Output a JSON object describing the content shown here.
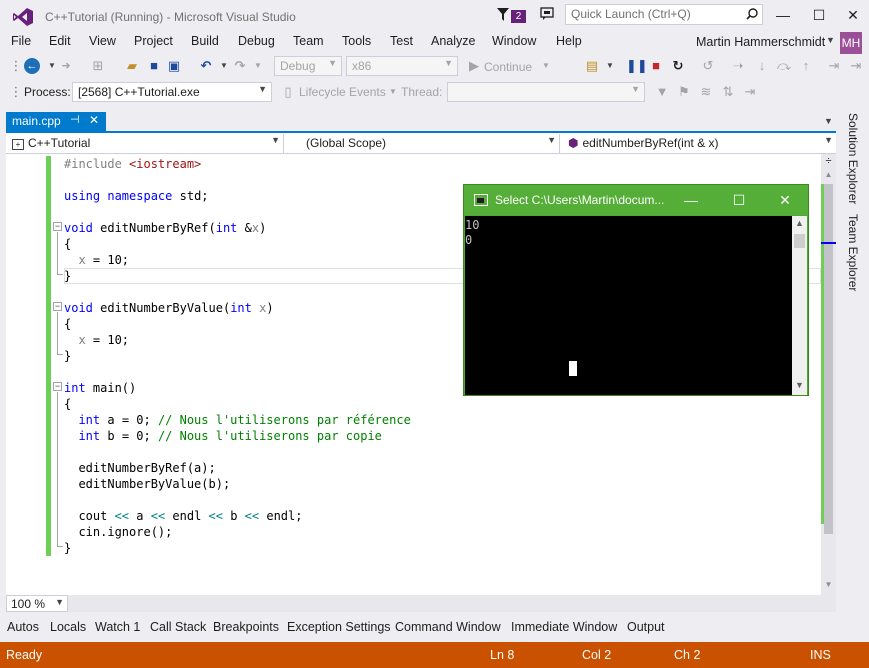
{
  "window": {
    "title": "C++Tutorial (Running) - Microsoft Visual Studio",
    "notifications": "2",
    "quick_launch_placeholder": "Quick Launch (Ctrl+Q)",
    "min": "—",
    "max": "☐",
    "close": "✕"
  },
  "menu": {
    "items": [
      "File",
      "Edit",
      "View",
      "Project",
      "Build",
      "Debug",
      "Team",
      "Tools",
      "Test",
      "Analyze",
      "Window",
      "Help"
    ],
    "user": "Martin Hammerschmidt",
    "avatar": "MH"
  },
  "toolbar": {
    "config": "Debug",
    "platform": "x86",
    "continue": "Continue"
  },
  "process_bar": {
    "label": "Process:",
    "process": "[2568] C++Tutorial.exe",
    "lifecycle": "Lifecycle Events",
    "thread_label": "Thread:"
  },
  "editor": {
    "tab": "main.cpp",
    "nav": {
      "project": "C++Tutorial",
      "scope": "(Global Scope)",
      "member": "editNumberByRef(int & x)"
    },
    "zoom": "100 %"
  },
  "side_tabs": [
    "Solution Explorer",
    "Team Explorer"
  ],
  "console": {
    "title": "Select C:\\Users\\Martin\\docum...",
    "output": [
      "10",
      "0"
    ]
  },
  "tool_windows": [
    "Autos",
    "Locals",
    "Watch 1",
    "Call Stack",
    "Breakpoints",
    "Exception Settings",
    "Command Window",
    "Immediate Window",
    "Output"
  ],
  "status": {
    "state": "Ready",
    "line": "Ln 8",
    "col": "Col 2",
    "ch": "Ch 2",
    "mode": "INS"
  },
  "colors": {
    "accent": "#007acc",
    "status_debug": "#ca5100",
    "console_frame": "#55ae38",
    "change_bar": "#6ece56"
  }
}
